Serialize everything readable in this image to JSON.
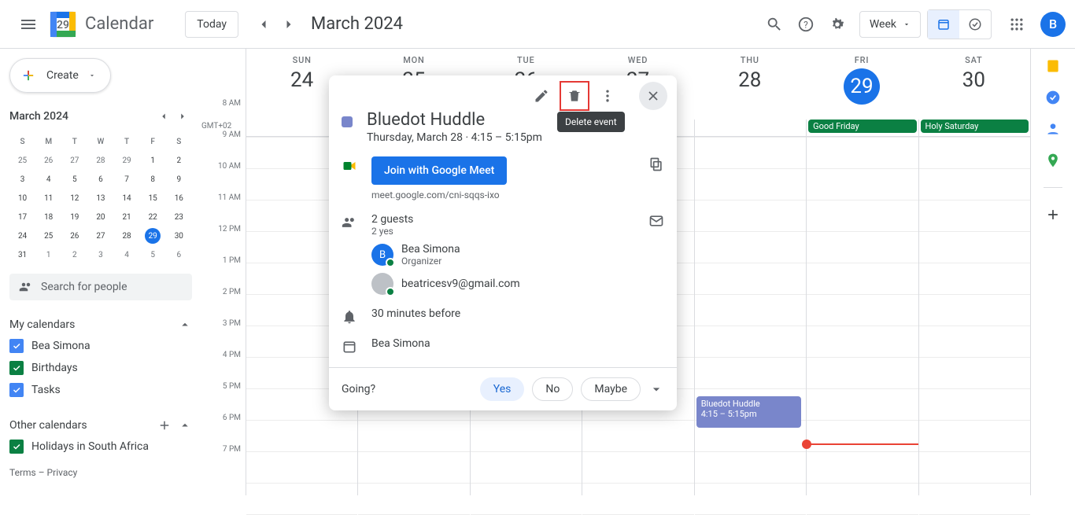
{
  "header": {
    "appName": "Calendar",
    "today": "Today",
    "monthTitle": "March 2024",
    "viewLabel": "Week",
    "avatarLetter": "B",
    "logoDay": "29"
  },
  "sidebar": {
    "create": "Create",
    "miniTitle": "March 2024",
    "dayHeaders": [
      "S",
      "M",
      "T",
      "W",
      "T",
      "F",
      "S"
    ],
    "weeks": [
      [
        "25",
        "26",
        "27",
        "28",
        "29",
        "1",
        "2"
      ],
      [
        "3",
        "4",
        "5",
        "6",
        "7",
        "8",
        "9"
      ],
      [
        "10",
        "11",
        "12",
        "13",
        "14",
        "15",
        "16"
      ],
      [
        "17",
        "18",
        "19",
        "20",
        "21",
        "22",
        "23"
      ],
      [
        "24",
        "25",
        "26",
        "27",
        "28",
        "29",
        "30"
      ],
      [
        "31",
        "1",
        "2",
        "3",
        "4",
        "5",
        "6"
      ]
    ],
    "selectedDay": "29",
    "selectedWeek": 4,
    "searchPlaceholder": "Search for people",
    "myCalLabel": "My calendars",
    "myCals": [
      {
        "label": "Bea Simona",
        "color": "blue"
      },
      {
        "label": "Birthdays",
        "color": "green"
      },
      {
        "label": "Tasks",
        "color": "blue"
      }
    ],
    "otherCalLabel": "Other calendars",
    "otherCals": [
      {
        "label": "Holidays in South Africa",
        "color": "green"
      }
    ],
    "terms": "Terms – Privacy"
  },
  "timezone": "GMT+02",
  "hours": [
    "8 AM",
    "9 AM",
    "10 AM",
    "11 AM",
    "12 PM",
    "1 PM",
    "2 PM",
    "3 PM",
    "4 PM",
    "5 PM",
    "6 PM",
    "7 PM"
  ],
  "days": [
    {
      "name": "SUN",
      "num": "24"
    },
    {
      "name": "MON",
      "num": "25"
    },
    {
      "name": "TUE",
      "num": "26"
    },
    {
      "name": "WED",
      "num": "27"
    },
    {
      "name": "THU",
      "num": "28"
    },
    {
      "name": "FRI",
      "num": "29",
      "today": true
    },
    {
      "name": "SAT",
      "num": "30"
    }
  ],
  "alldayEvents": {
    "5": "Good Friday",
    "6": "Holy Saturday"
  },
  "eventBlock": {
    "title": "Bluedot Huddle",
    "time": "4:15 – 5:15pm"
  },
  "popup": {
    "title": "Bluedot Huddle",
    "subtitle": "Thursday, March 28  ·  4:15 – 5:15pm",
    "tooltip": "Delete event",
    "meetBtn": "Join with Google Meet",
    "meetLink": "meet.google.com/cni-sqqs-ixo",
    "guestsCount": "2 guests",
    "guestsYes": "2 yes",
    "guests": [
      {
        "name": "Bea Simona",
        "sub": "Organizer",
        "letter": "B"
      },
      {
        "name": "beatricesv9@gmail.com",
        "sub": "",
        "letter": ""
      }
    ],
    "notification": "30 minutes before",
    "calendar": "Bea Simona",
    "going": "Going?",
    "yes": "Yes",
    "no": "No",
    "maybe": "Maybe"
  }
}
